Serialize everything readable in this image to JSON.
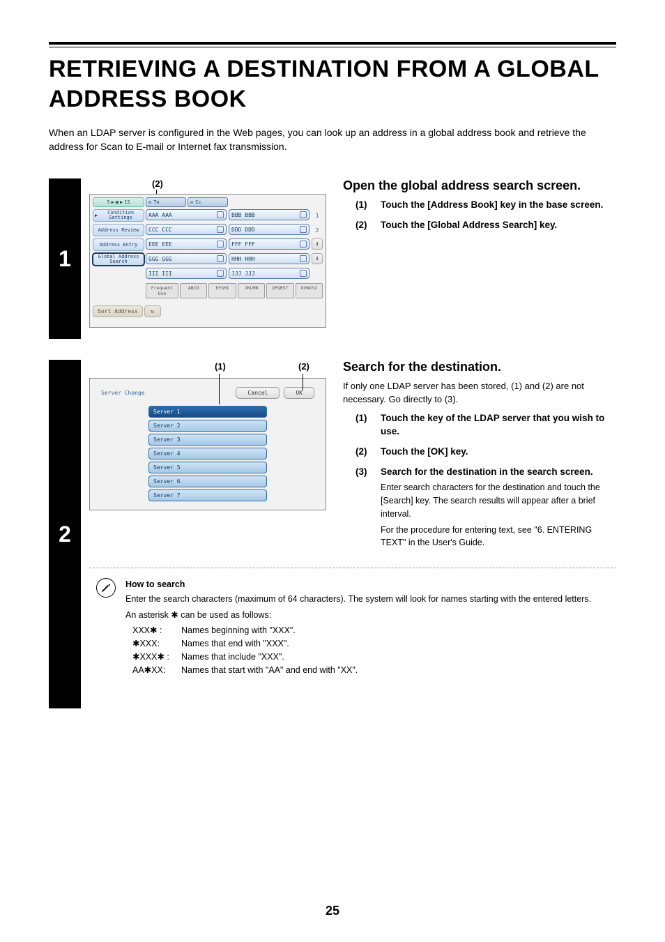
{
  "title": "RETRIEVING A DESTINATION FROM A GLOBAL ADDRESS BOOK",
  "intro": "When an LDAP server is configured in the Web pages, you can look up an address in a global address book and retrieve the address for Scan to E-mail or Internet fax transmission.",
  "page_number": "25",
  "step1": {
    "number": "1",
    "callout2": "(2)",
    "heading": "Open the global address search screen.",
    "items": [
      {
        "num": "(1)",
        "txt": "Touch the [Address Book] key in the base screen."
      },
      {
        "num": "(2)",
        "txt": "Touch the [Global Address Search] key."
      }
    ],
    "panel": {
      "top_number": "5",
      "top_number2": "15",
      "to_label": "To",
      "cc_label": "Cc",
      "side_items": [
        "Condition Settings",
        "Address Review",
        "Address Entry",
        "Global Address Search"
      ],
      "side_active_index": 3,
      "addresses": [
        "AAA AAA",
        "BBB BBB",
        "CCC CCC",
        "DDD DDD",
        "EEE EEE",
        "FFF FFF",
        "GGG GGG",
        "HHH HHH",
        "III III",
        "JJJ JJJ"
      ],
      "page_indicator_1": "1",
      "page_indicator_2": "2",
      "freq_label": "Frequent Use",
      "tabs": [
        "ABCD",
        "EFGHI",
        "JKLMN",
        "OPQRST",
        "UVWXYZ"
      ],
      "sort_label": "Sort Address"
    }
  },
  "step2": {
    "number": "2",
    "callout1": "(1)",
    "callout2": "(2)",
    "heading": "Search for the destination.",
    "lead": "If only one LDAP server has been stored, (1) and (2) are not necessary. Go directly to (3).",
    "items": [
      {
        "num": "(1)",
        "txt": "Touch the key of the LDAP server that you wish to use."
      },
      {
        "num": "(2)",
        "txt": "Touch the [OK] key."
      },
      {
        "num": "(3)",
        "txt": "Search for the destination in the search screen.",
        "after1": "Enter search characters for the destination and touch the [Search] key. The search results will appear after a brief interval.",
        "after2": "For the procedure for entering text, see \"6. ENTERING TEXT\" in the User's Guide."
      }
    ],
    "panel": {
      "server_change": "Server Change",
      "cancel": "Cancel",
      "ok": "OK",
      "servers": [
        "Server 1",
        "Server 2",
        "Server 3",
        "Server 4",
        "Server 5",
        "Server 6",
        "Server 7"
      ],
      "selected_index": 0
    },
    "note": {
      "head": "How to search",
      "body": "Enter the search characters (maximum of 64 characters). The system will look for names starting with the entered letters.",
      "asterisk_intro": "An asterisk ✱ can be used as follows:",
      "rows": [
        {
          "k": "XXX✱ :",
          "v": "Names beginning with \"XXX\"."
        },
        {
          "k": "✱XXX:",
          "v": "Names that end with \"XXX\"."
        },
        {
          "k": "✱XXX✱ :",
          "v": "Names that include \"XXX\"."
        },
        {
          "k": "AA✱XX:",
          "v": "Names that start with \"AA\" and end with \"XX\"."
        }
      ]
    }
  }
}
